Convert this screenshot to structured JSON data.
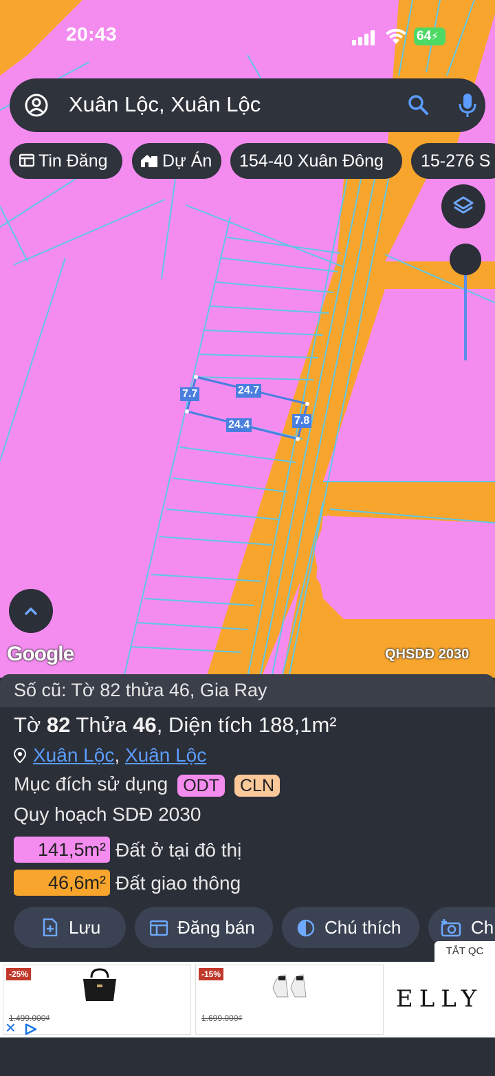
{
  "status": {
    "time": "20:43",
    "battery": "64"
  },
  "search": {
    "query": "Xuân Lộc, Xuân Lộc"
  },
  "chips": [
    "Tin Đăng",
    "Dự Án",
    "154-40 Xuân Đông",
    "15-276 S"
  ],
  "map": {
    "colors": {
      "residential": "#f48cf0",
      "road": "#f7a52c",
      "parcel_line": "#5fc6e6",
      "measure": "#4a7fe0"
    },
    "measures": {
      "top": "24.7",
      "bottom": "24.4",
      "left": "7.7",
      "right": "7.8"
    },
    "google_label": "Google",
    "layer_label": "QHSDĐ 2030"
  },
  "sheet": {
    "old_number": "Số cũ: Tờ 82 thửa 46, Gia Ray",
    "title_prefix": "Tờ ",
    "sheet_no": "82",
    "title_mid": " Thửa ",
    "parcel_no": "46",
    "title_area": ", Diện tích 188,1m²",
    "location_1": "Xuân Lộc",
    "location_sep": ",",
    "location_2": "Xuân Lộc",
    "purpose_label": "Mục đích sử dụng",
    "purpose_tags": [
      "ODT",
      "CLN"
    ],
    "plan_label": "Quy hoạch SDĐ 2030",
    "plan_items": [
      {
        "area": "141,5m²",
        "label": "Đất ở tại đô thị",
        "color": "#f48cf0"
      },
      {
        "area": "46,6m²",
        "label": "Đất giao thông",
        "color": "#f7a52c"
      }
    ]
  },
  "actions": [
    "Lưu",
    "Đăng bán",
    "Chú thích",
    "Ch"
  ],
  "ad": {
    "label": "TẮT QC",
    "cards": [
      {
        "discount": "-25%",
        "old_price": "1.499.000₫"
      },
      {
        "discount": "-15%",
        "old_price": "1.699.000₫"
      }
    ],
    "brand": "ELLY"
  }
}
